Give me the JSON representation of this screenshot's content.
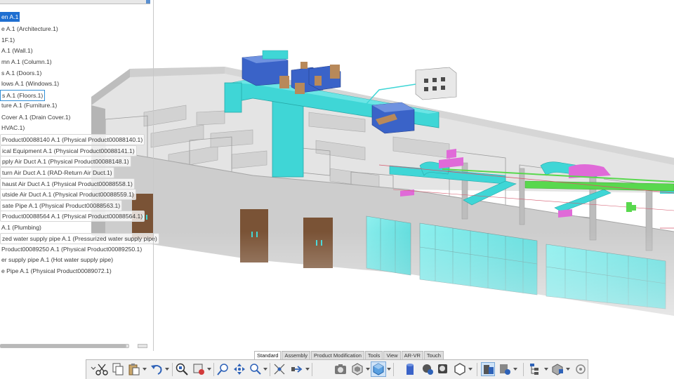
{
  "tree": {
    "items": [
      {
        "text": "en A.1",
        "state": "selected"
      },
      {
        "text": "e A.1 (Architecture.1)",
        "state": ""
      },
      {
        "text": "1F.1)",
        "state": ""
      },
      {
        "text": "A.1 (Wall.1)",
        "state": ""
      },
      {
        "text": "mn A.1 (Column.1)",
        "state": ""
      },
      {
        "text": "s A.1 (Doors.1)",
        "state": ""
      },
      {
        "text": "lows A.1 (Windows.1)",
        "state": ""
      },
      {
        "text": "s A.1 (Floors.1)",
        "state": "outlined"
      },
      {
        "text": "ture A.1 (Furniture.1)",
        "state": ""
      },
      {
        "text": "Cover A.1 (Drain Cover.1)",
        "state": ""
      },
      {
        "text": "HVAC.1)",
        "state": ""
      },
      {
        "text": "Product00088140 A.1 (Physical Product00088140.1)",
        "state": "boxed"
      },
      {
        "text": "ical Equipment A.1 (Physical Product00088141.1)",
        "state": "boxed"
      },
      {
        "text": "pply Air Duct A.1 (Physical Product00088148.1)",
        "state": "boxed"
      },
      {
        "text": "turn Air Duct A.1 (RAD-Return Air Duct.1)",
        "state": "boxed"
      },
      {
        "text": "haust Air Duct A.1 (Physical Product00088558.1)",
        "state": "boxed"
      },
      {
        "text": "utside Air Duct A.1 (Physical Product00088559.1)",
        "state": "boxed"
      },
      {
        "text": "sate Pipe A.1 (Physical Product00088563.1)",
        "state": "boxed"
      },
      {
        "text": "Product00088564 A.1 (Physical Product00088564.1)",
        "state": "boxed"
      },
      {
        "text": "A.1 (Plumbing)",
        "state": ""
      },
      {
        "text": "zed water supply pipe A.1 (Pressurized water supply pipe)",
        "state": "boxed"
      },
      {
        "text": "Product00089250 A.1 (Physical Product00089250.1)",
        "state": ""
      },
      {
        "text": "er supply pipe A.1 (Hot water supply pipe)",
        "state": ""
      },
      {
        "text": "e Pipe A.1 (Physical Product00089072.1)",
        "state": ""
      }
    ]
  },
  "tabs": [
    {
      "label": "Standard",
      "active": true
    },
    {
      "label": "Assembly",
      "active": false
    },
    {
      "label": "Product Modification",
      "active": false
    },
    {
      "label": "Tools",
      "active": false
    },
    {
      "label": "View",
      "active": false
    },
    {
      "label": "AR-VR",
      "active": false
    },
    {
      "label": "Touch",
      "active": false
    }
  ],
  "toolbar": {
    "icons": [
      "overflow-chevron-icon",
      "cut-icon",
      "copy-icon",
      "paste-icon",
      "undo-icon",
      "zoom-fit-icon",
      "fly-mode-icon",
      "zoom-area-icon",
      "pan-icon",
      "zoom-icon",
      "normal-view-icon",
      "explode-icon",
      "view-cube-icon",
      "capture-icon",
      "render-style-icon",
      "iso-view-icon",
      "hide-show-icon",
      "swap-visible-icon",
      "material-icon",
      "create-group-icon",
      "cover-icon",
      "screen-icon",
      "compass-icon",
      "tree-display-icon",
      "assembly-icon",
      "refresh-icon"
    ]
  },
  "colors": {
    "duct_cyan": "#3fd6d6",
    "ahu_blue": "#3a63c8",
    "pipe_magenta": "#e06ad8",
    "pipe_green": "#59d84e",
    "wall_gray": "#c9c9c9",
    "door_brown": "#7a5336",
    "selection_blue": "#1f6fd1"
  }
}
